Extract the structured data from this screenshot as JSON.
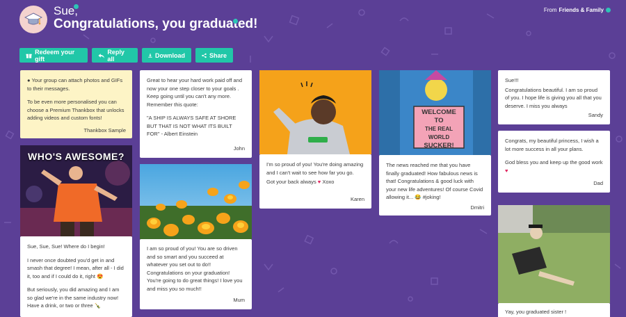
{
  "header": {
    "greeting": "Sue,",
    "title": "Congratulations, you graduated!",
    "from_prefix": "From",
    "from_name": "Friends & Family"
  },
  "toolbar": {
    "redeem_label": "Redeem your gift",
    "reply_label": "Reply all",
    "download_label": "Download",
    "share_label": "Share"
  },
  "cards": {
    "info": {
      "line1": "Your group can attach photos and GIFs to their messages.",
      "line2": "To be even more personalised you can choose a Premium Thankbox that unlocks adding videos and custom fonts!",
      "sign": "Thankbox Sample"
    },
    "gif": {
      "caption": "WHO'S AWESOME?"
    },
    "sue_sue": {
      "p1": "Sue, Sue, Sue! Where do I begin!",
      "p2": "I never once doubted you'd get in and smash that degree! I mean, after all - I did it, too and if I could do it, right 😍",
      "p3": "But seriously, you did amazing and I am so glad we're in the same industry now! Have a drink, or two or three 🍾"
    },
    "john": {
      "p1": "Great to hear your hard work paid off and now your one step closer to your goals . Keep going until you can't any more. Remember this quote:",
      "p2": "\"A SHIP IS ALWAYS SAFE AT SHORE BUT THAT IS NOT WHAT ITS BUILT FOR\" - Albert Einstein",
      "sign": "John"
    },
    "mum": {
      "p1": "I am so proud of you! You are so driven and so smart and you succeed at whatever you set out to do!! Congratulations on your graduation! You're going to do great things! I love you and miss you so much!!",
      "sign": "Mum"
    },
    "karen": {
      "p1": "I'm so proud of you! You're doing amazing and I can't wait to see how far you go.",
      "p2": "Got your back always",
      "p2b": "Xoxo",
      "sign": "Karen"
    },
    "dmitri": {
      "sign_text1": "WELCOME",
      "sign_text2": "TO",
      "sign_text3": "THE REAL WORLD",
      "sign_text4": "SUCKER!",
      "p1": "The news reached me that you have finally graduated!  How fabulous news is that! Congratulations & good luck with your new life adventures! Of course Covid allowing it... 😂 #joking!",
      "sign": "Dmitri"
    },
    "sandy": {
      "p1": "Sue!!!",
      "p2": "Congratulations beautiful. I am so proud of you. I hope life is giving you all that you deserve. I miss you always",
      "sign": "Sandy"
    },
    "dad": {
      "p1": "Congrats, my beautiful princess, I wish a lot more success in all your plans.",
      "p2": "God bless you and keep up the good work",
      "sign": "Dad"
    },
    "sister": {
      "p1": "Yay, you graduated sister !"
    }
  },
  "colors": {
    "background": "#5b3f96",
    "accent": "#21c7a8",
    "info_card": "#fdf4c6"
  }
}
